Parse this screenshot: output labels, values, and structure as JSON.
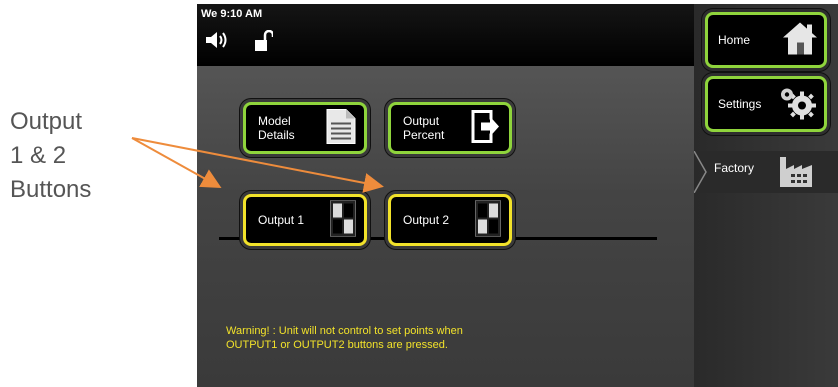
{
  "callout": {
    "line1": "Output",
    "line2": "1 & 2",
    "line3": "Buttons"
  },
  "statusbar": {
    "time": "We 9:10 AM",
    "icons": [
      "speaker-icon",
      "unlocked-padlock-icon"
    ]
  },
  "buttons": {
    "model_details": {
      "line1": "Model",
      "line2": "Details",
      "icon": "document-icon"
    },
    "output_percent": {
      "line1": "Output",
      "line2": "Percent",
      "icon": "exit-arrow-icon"
    },
    "output1": {
      "label": "Output 1",
      "icon": "toggle-switch-icon"
    },
    "output2": {
      "label": "Output 2",
      "icon": "toggle-switch-icon"
    }
  },
  "warning": {
    "line1": "Warning! : Unit will not control to set points when",
    "line2": "OUTPUT1 or OUTPUT2 buttons are pressed."
  },
  "sidebar": {
    "home": {
      "label": "Home",
      "icon": "house-icon"
    },
    "settings": {
      "label": "Settings",
      "icon": "gears-icon"
    },
    "factory": {
      "label": "Factory",
      "icon": "factory-icon"
    }
  },
  "colors": {
    "green_border": "#8fd43c",
    "yellow_border": "#f2e22a",
    "warning_text": "#f2e22a",
    "callout_text": "#555555",
    "arrow": "#ee8c3c"
  }
}
